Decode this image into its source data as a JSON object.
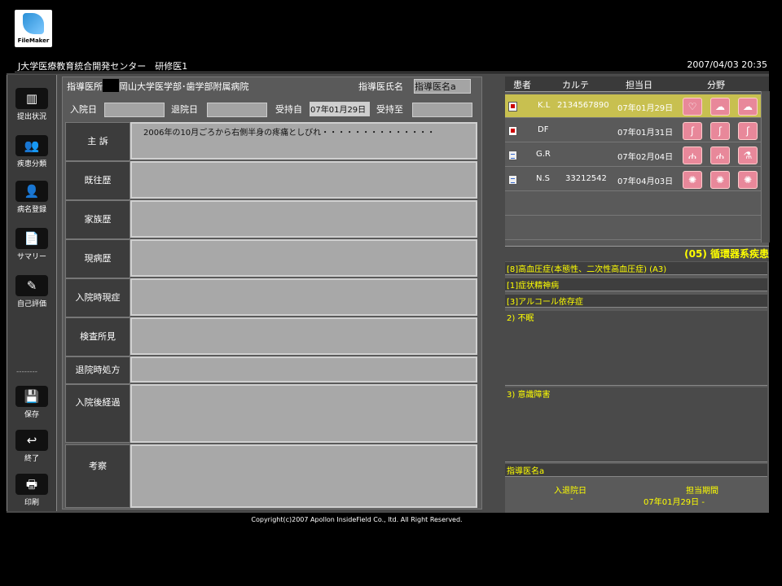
{
  "logo": {
    "text": "FileMaker"
  },
  "titlebar": {
    "left": "J大学医療教育統合開発センター　研修医1",
    "right": "2007/04/03 20:35"
  },
  "sidebar": {
    "items": [
      {
        "label": "提出状況",
        "icon": "bar-chart-icon",
        "glyph": "▥"
      },
      {
        "label": "疾患分類",
        "icon": "people-icon",
        "glyph": "👥"
      },
      {
        "label": "病名登録",
        "icon": "person-icon",
        "glyph": "👤"
      },
      {
        "label": "サマリー",
        "icon": "document-icon",
        "glyph": "📄"
      },
      {
        "label": "自己評価",
        "icon": "notepad-edit-icon",
        "glyph": "✎"
      }
    ],
    "separator": "--------",
    "bottom": [
      {
        "label": "保存",
        "icon": "floppy-disk-icon",
        "glyph": "💾"
      },
      {
        "label": "終了",
        "icon": "return-arrow-icon",
        "glyph": "↩"
      },
      {
        "label": "印刷",
        "icon": "printer-icon",
        "glyph": "🖶"
      }
    ]
  },
  "form": {
    "supervisor_hospital_label": "指導医所",
    "hospital": "岡山大学医学部･歯学部附属病院",
    "supervisor_name_label": "指導医氏名",
    "supervisor_name": "指導医名a",
    "admission_label": "入院日",
    "admission_value": "",
    "discharge_label": "退院日",
    "discharge_value": "",
    "charge_from_label": "受持自",
    "charge_from_value": "07年01月29日",
    "charge_to_label": "受持至",
    "charge_to_value": "",
    "rows": [
      {
        "label": "主 訴",
        "value": "2006年の10月ごろから右側半身の疼痛としびれ・・・・・・・・・・・・・・"
      },
      {
        "label": "既往歴",
        "value": ""
      },
      {
        "label": "家族歴",
        "value": ""
      },
      {
        "label": "現病歴",
        "value": ""
      },
      {
        "label": "入院時現症",
        "value": ""
      },
      {
        "label": "検査所見",
        "value": ""
      },
      {
        "label": "退院時処方",
        "value": ""
      },
      {
        "label": "入院後経過",
        "value": ""
      },
      {
        "label": "考察",
        "value": ""
      }
    ]
  },
  "patients": {
    "headers": [
      "患者",
      "カルテ",
      "担当日",
      "分野"
    ],
    "rows": [
      {
        "name": "K.L",
        "chart": "2134567890",
        "date": "07年01月29日",
        "icons": [
          "heart-icon",
          "brain-icon",
          "brain-icon"
        ],
        "glyphs": [
          "♡",
          "☁",
          "☁"
        ],
        "selected": true
      },
      {
        "name": "DF",
        "chart": "",
        "date": "07年01月31日",
        "icons": [
          "stomach-icon",
          "stomach-icon",
          "stomach-icon"
        ],
        "glyphs": [
          "ʃ",
          "ʃ",
          "ʃ"
        ],
        "selected": false
      },
      {
        "name": "G.R",
        "chart": "",
        "date": "07年02月04日",
        "icons": [
          "lungs-icon",
          "lungs-icon",
          "flask-icon"
        ],
        "glyphs": [
          "ሐ",
          "ሐ",
          "⚗"
        ],
        "selected": false
      },
      {
        "name": "N.S",
        "chart": "33212542",
        "date": "07年04月03日",
        "icons": [
          "virus-icon",
          "virus-icon",
          "virus-icon"
        ],
        "glyphs": [
          "✺",
          "✺",
          "✺"
        ],
        "selected": false
      }
    ],
    "accent": "#c8c050",
    "icon_color": "#e8889a"
  },
  "diagnosis": {
    "department": "(05) 循環器系疾患",
    "items": [
      "[8]高血圧症(本態性、二次性高血圧症) (A3)",
      "[1]症状精神病",
      "[3]アルコール依存症"
    ],
    "note1": "2) 不眠",
    "note2": "3) 意識障害",
    "supervisor": "指導医名a",
    "period_label_left": "入退院日",
    "period_label_right": "担当期間",
    "period_value_left": "-",
    "period_value_right": "07年01月29日 -"
  },
  "copyright": "Copyright(c)2007 Apollon InsideField Co., ltd. All Right Reserved."
}
